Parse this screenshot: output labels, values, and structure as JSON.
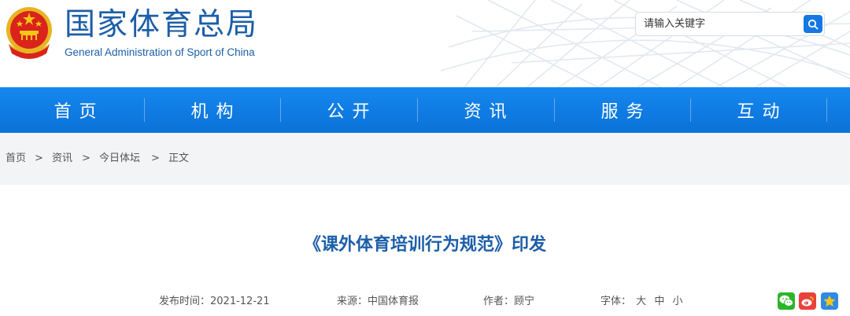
{
  "header": {
    "title_cn": "国家体育总局",
    "title_en": "General Administration of Sport of China",
    "emblem_icon": "national-emblem-icon"
  },
  "search": {
    "placeholder": "请输入关键字",
    "button_icon": "search-icon"
  },
  "nav": {
    "items": [
      {
        "label": "首页"
      },
      {
        "label": "机构"
      },
      {
        "label": "公开"
      },
      {
        "label": "资讯"
      },
      {
        "label": "服务"
      },
      {
        "label": "互动"
      }
    ]
  },
  "breadcrumb": {
    "items": [
      "首页",
      "资讯",
      "今日体坛",
      "正文"
    ],
    "separator": ">"
  },
  "article": {
    "title": "《课外体育培训行为规范》印发",
    "meta": {
      "date_label": "发布时间：",
      "date": "2021-12-21",
      "source_label": "来源：",
      "source": "中国体育报",
      "author_label": "作者：",
      "author": "顾宁",
      "font_label": "字体：",
      "font_large": "大",
      "font_medium": "中",
      "font_small": "小"
    }
  },
  "share": {
    "icons": [
      "wechat-icon",
      "weibo-icon",
      "favorite-star-icon"
    ]
  },
  "colors": {
    "brand_blue": "#1c5ea8",
    "nav_blue": "#0d7ae0",
    "crumb_bg": "#f3f4f6",
    "wechat_green": "#2bb52b",
    "weibo_red": "#e8423a",
    "star_blue": "#2f8ae6"
  }
}
